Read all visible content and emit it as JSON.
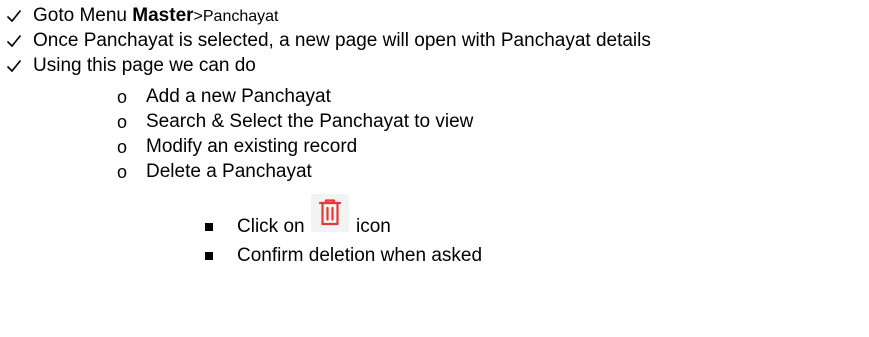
{
  "steps": [
    {
      "prefix": "Goto Menu ",
      "bold": "Master",
      "suffix": ">Panchayat"
    },
    {
      "text": "Once Panchayat is selected, a new page will open with Panchayat details"
    },
    {
      "text": "Using this page we can do"
    }
  ],
  "actions": [
    "Add a new Panchayat",
    "Search & Select the Panchayat to view",
    "Modify an existing record",
    "Delete a Panchayat"
  ],
  "delete_substeps": {
    "click_prefix": "Click on",
    "click_suffix": "icon",
    "confirm": "Confirm deletion when asked"
  },
  "bullet_marker": "o",
  "icons": {
    "check": "check-icon",
    "delete": "trash-icon"
  },
  "colors": {
    "text": "#000000",
    "delete_icon": "#e53935",
    "delete_icon_bg": "#f3f3f3"
  }
}
